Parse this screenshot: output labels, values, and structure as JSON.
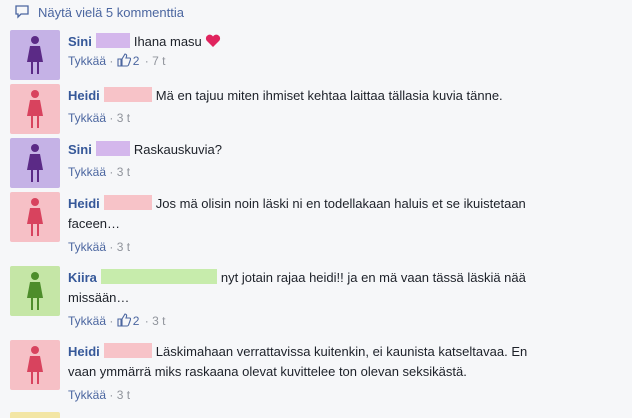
{
  "header": {
    "more_comments": "Näytä vielä 5 kommenttia"
  },
  "colors": {
    "link": "#365899",
    "meta": "#90949c",
    "purple_avatar": "#c5b2e6",
    "pink_avatar": "#f6c0c6",
    "green_avatar": "#c5e6a6",
    "purple_icon": "#5b2a86",
    "pink_icon": "#d8435e",
    "green_icon": "#4d8d2b"
  },
  "comments": [
    {
      "name": "Sini",
      "text": "Ihana masu",
      "like_label": "Tykkää",
      "likes": "2",
      "time": "7 t",
      "avatar_color": "purple",
      "emoji": "heart-icon"
    },
    {
      "name": "Heidi",
      "text": "Mä en tajuu miten ihmiset kehtaa laittaa tällasia kuvia tänne.",
      "like_label": "Tykkää",
      "time": "3 t",
      "avatar_color": "pink"
    },
    {
      "name": "Sini",
      "text": "Raskauskuvia?",
      "like_label": "Tykkää",
      "time": "3 t",
      "avatar_color": "purple"
    },
    {
      "name": "Heidi",
      "text": "Jos mä olisin noin läski ni en todellakaan haluis et se ikuistetaan",
      "text2": "faceen…",
      "like_label": "Tykkää",
      "time": "3 t",
      "avatar_color": "pink"
    },
    {
      "name": "Kiira",
      "text": "nyt jotain rajaa heidi!! ja en mä vaan tässä läskiä nää",
      "text2": "missään…",
      "like_label": "Tykkää",
      "likes": "2",
      "time": "3 t",
      "avatar_color": "green"
    },
    {
      "name": "Heidi",
      "text": "Läskimahaan verrattavissa kuitenkin, ei kaunista katseltavaa. En",
      "text2": "vaan ymmärrä miks raskaana olevat kuvittelee ton olevan seksikästä.",
      "like_label": "Tykkää",
      "time": "3 t",
      "avatar_color": "pink"
    }
  ],
  "sep": "·"
}
